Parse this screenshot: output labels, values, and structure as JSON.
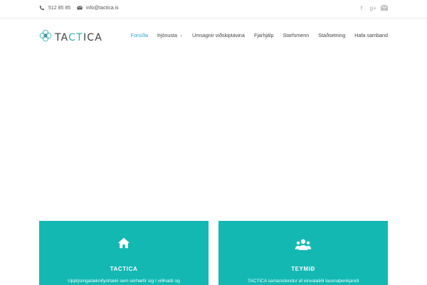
{
  "topbar": {
    "phone": {
      "icon": "phone-icon",
      "text": "512 85 85"
    },
    "email": {
      "icon": "envelope-icon",
      "text": "info@tactica.is"
    },
    "social": [
      {
        "icon": "facebook-icon",
        "glyph": "f"
      },
      {
        "icon": "google-plus-icon",
        "glyph": "g+"
      },
      {
        "icon": "envelope-icon",
        "glyph": "✉"
      }
    ]
  },
  "header": {
    "logo": {
      "prefix": "TA",
      "accent": "CT",
      "suffix": "ICA",
      "accent_color": "#2bb6b0"
    },
    "nav": [
      {
        "label": "Forsíða",
        "active": true
      },
      {
        "label": "Þjónusta",
        "has_dropdown": true
      },
      {
        "label": "Umsagnir viðskiptavina"
      },
      {
        "label": "Fjarhjálp"
      },
      {
        "label": "Starfsmenn"
      },
      {
        "label": "Staðsetning"
      },
      {
        "label": "Hafa samband"
      }
    ]
  },
  "cards": [
    {
      "icon": "home-icon",
      "title": "TACTICA",
      "text": "Upplýsingatæknifyrirtæki sem sérhæfir sig í viðhaldi og"
    },
    {
      "icon": "users-icon",
      "title": "TEYMIÐ",
      "text": "TACTICA samanstendur af einvalaliði lausnaþenkjandi"
    }
  ],
  "colors": {
    "teal": "#14b8b3",
    "nav_active": "#2aa6d4",
    "social_grey": "#c2c2c2"
  }
}
